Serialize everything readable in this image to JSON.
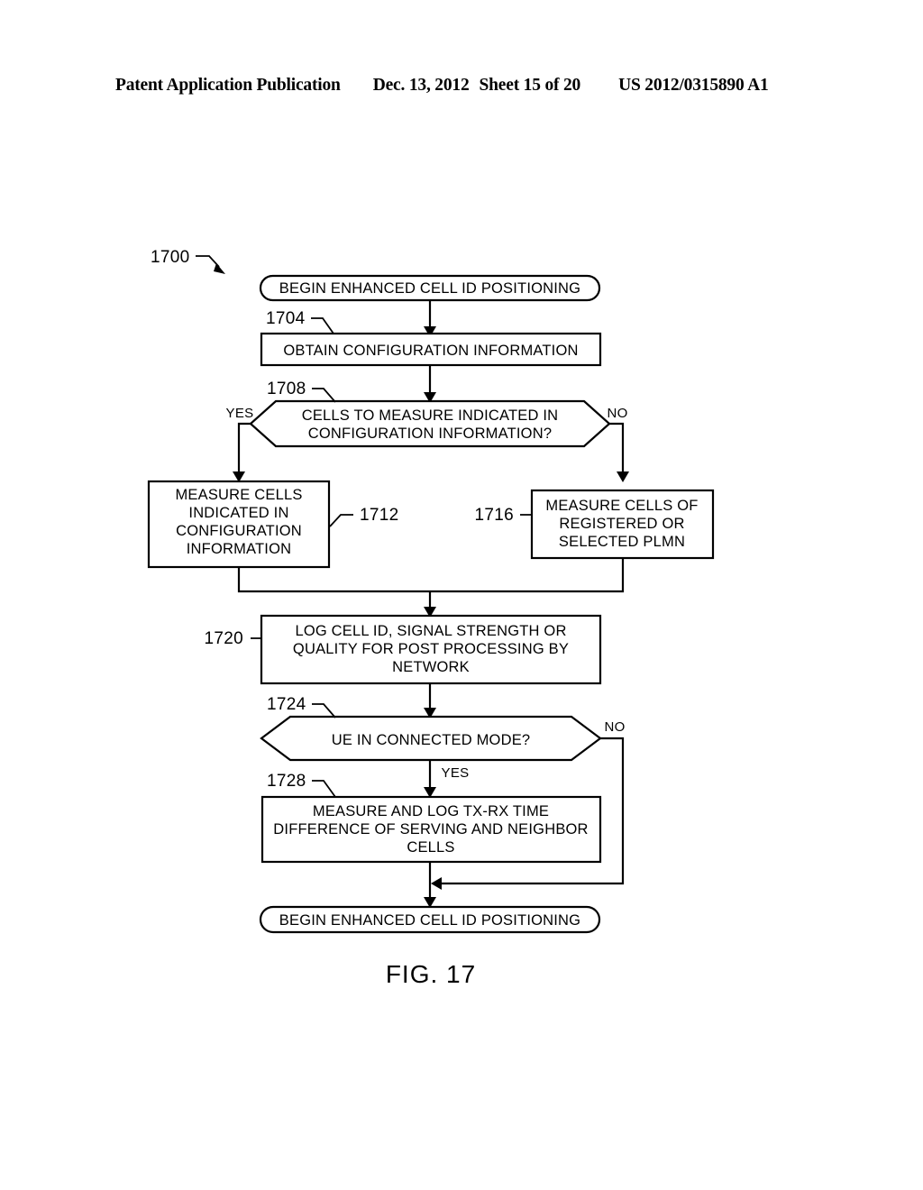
{
  "header": {
    "publication": "Patent Application Publication",
    "date": "Dec. 13, 2012",
    "sheet": "Sheet 15 of 20",
    "patent_number": "US 2012/0315890 A1"
  },
  "figure": {
    "caption": "FIG. 17",
    "diagram_ref": "1700"
  },
  "flowchart": {
    "nodes": [
      {
        "ref": "1700",
        "type": "diagram-label",
        "label": "1700"
      },
      {
        "ref": "",
        "type": "terminator",
        "label": "BEGIN ENHANCED CELL ID POSITIONING",
        "lines": [
          "BEGIN ENHANCED CELL ID POSITIONING"
        ]
      },
      {
        "ref": "1704",
        "type": "process",
        "label": "OBTAIN CONFIGURATION INFORMATION",
        "lines": [
          "OBTAIN CONFIGURATION INFORMATION"
        ]
      },
      {
        "ref": "1708",
        "type": "decision",
        "label": "CELLS TO MEASURE INDICATED IN CONFIGURATION INFORMATION?",
        "lines": [
          "CELLS TO MEASURE INDICATED IN",
          "CONFIGURATION INFORMATION?"
        ]
      },
      {
        "ref": "1712",
        "type": "process",
        "label": "MEASURE CELLS INDICATED IN CONFIGURATION INFORMATION",
        "lines": [
          "MEASURE CELLS",
          "INDICATED IN",
          "CONFIGURATION",
          "INFORMATION"
        ]
      },
      {
        "ref": "1716",
        "type": "process",
        "label": "MEASURE CELLS OF REGISTERED OR SELECTED PLMN",
        "lines": [
          "MEASURE CELLS OF",
          "REGISTERED OR",
          "SELECTED PLMN"
        ]
      },
      {
        "ref": "1720",
        "type": "process",
        "label": "LOG CELL ID, SIGNAL STRENGTH OR QUALITY FOR POST PROCESSING BY NETWORK",
        "lines": [
          "LOG CELL ID, SIGNAL STRENGTH OR",
          "QUALITY FOR POST PROCESSING BY",
          "NETWORK"
        ]
      },
      {
        "ref": "1724",
        "type": "decision",
        "label": "UE IN CONNECTED MODE?",
        "lines": [
          "UE IN CONNECTED MODE?"
        ]
      },
      {
        "ref": "1728",
        "type": "process",
        "label": "MEASURE AND LOG TX-RX TIME DIFFERENCE OF SERVING AND NEIGHBOR CELLS",
        "lines": [
          "MEASURE AND LOG TX-RX TIME",
          "DIFFERENCE OF SERVING AND NEIGHBOR",
          "CELLS"
        ]
      },
      {
        "ref": "",
        "type": "terminator",
        "label": "BEGIN ENHANCED CELL ID POSITIONING",
        "lines": [
          "BEGIN ENHANCED CELL ID POSITIONING"
        ]
      }
    ],
    "branch_labels": {
      "d1708_yes": "YES",
      "d1708_no": "NO",
      "d1724_yes": "YES",
      "d1724_no": "NO"
    },
    "refs": {
      "r1700": "1700",
      "r1704": "1704",
      "r1708": "1708",
      "r1712": "1712",
      "r1716": "1716",
      "r1720": "1720",
      "r1724": "1724",
      "r1728": "1728"
    }
  },
  "colors": {
    "ink": "#000000",
    "paper": "#ffffff"
  }
}
